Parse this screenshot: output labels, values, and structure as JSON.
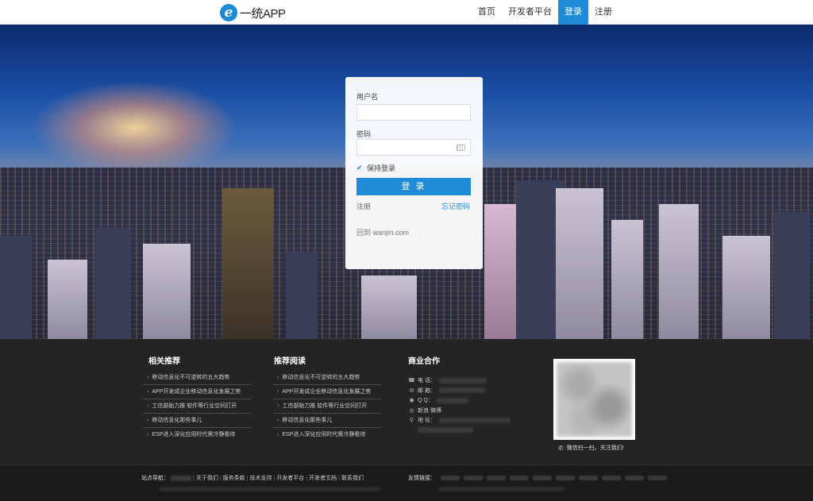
{
  "header": {
    "logo_mark": "e",
    "logo_text": "一统APP",
    "nav": [
      {
        "label": "首页",
        "active": false
      },
      {
        "label": "开发者平台",
        "active": false
      },
      {
        "label": "登录",
        "active": true
      },
      {
        "label": "注册",
        "active": false
      }
    ]
  },
  "login": {
    "username_label": "用户名",
    "username_value": "",
    "password_label": "密码",
    "password_value": "",
    "remember_label": "保持登录",
    "remember_checked": true,
    "submit_label": "登 录",
    "register_link": "注册",
    "forgot_link": "忘记密码",
    "back_link": "回到 wanjm.com"
  },
  "footer": {
    "col1": {
      "title": "相关推荐",
      "items": [
        "移动信息化不可逆转的五大趋势",
        "APP开发成企业移动信息化发展之势",
        "工信部助力推 软件等行业空间打开",
        "移动信息化那些事儿",
        "ESP进入深化应用时代需冷静看待"
      ]
    },
    "col2": {
      "title": "推荐阅读",
      "items": [
        "移动信息化不可逆转的五大趋势",
        "APP开发成企业移动信息化发展之势",
        "工信部助力推 软件等行业空间打开",
        "移动信息化那些事儿",
        "ESP进入深化应用时代需冷静看待"
      ]
    },
    "col3": {
      "title": "商业合作",
      "contact": [
        {
          "icon": "phone-icon",
          "glyph": "☎",
          "label": "电 话："
        },
        {
          "icon": "mail-icon",
          "glyph": "✉",
          "label": "邮 箱："
        },
        {
          "icon": "qq-icon",
          "glyph": "◉",
          "label": "Q Q："
        },
        {
          "icon": "weibo-icon",
          "glyph": "◎",
          "label": "新浪 微博"
        },
        {
          "icon": "location-icon",
          "glyph": "⚲",
          "label": "地 址："
        }
      ]
    },
    "qr_caption": "微信扫一扫，关注我们!"
  },
  "bottom": {
    "site_nav_label": "站点导航：",
    "site_links": [
      "关于我们",
      "服务条款",
      "技术支持",
      "开发者平台",
      "开发者文档",
      "联系我们"
    ],
    "friend_label": "友情链接："
  },
  "colors": {
    "accent": "#1f8bd8",
    "footer_bg": "#242424",
    "bottom_bg": "#1a1a1a"
  }
}
